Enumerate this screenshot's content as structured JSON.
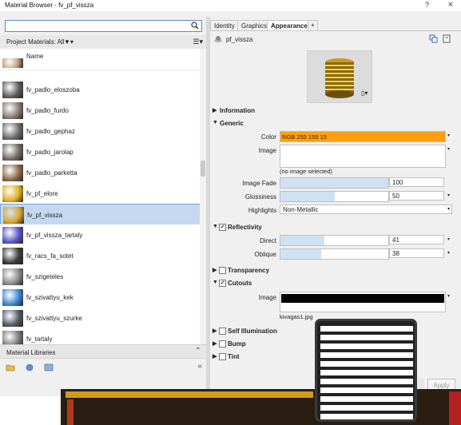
{
  "window": {
    "title": "Material Browser - fv_pf_vissza",
    "help": "?",
    "close": "×"
  },
  "left": {
    "search": {
      "value": "",
      "placeholder": ""
    },
    "filter_label": "Project Materials: All",
    "column_header": "Name",
    "materials": [
      {
        "name": "",
        "color": "#c8a37a"
      },
      {
        "name": "fv_padlo_eloszoba",
        "color": "#5c5c5c"
      },
      {
        "name": "fv_padlo_furdo",
        "color": "#8a7a6e"
      },
      {
        "name": "fv_padlo_gephaz",
        "color": "#6b6b6b"
      },
      {
        "name": "fv_padlo_jarolap",
        "color": "#726a62"
      },
      {
        "name": "fv_padlo_parketta",
        "color": "#8c6a4a"
      },
      {
        "name": "fv_pf_elore",
        "color": "#e0b020"
      },
      {
        "name": "fv_pf_vissza",
        "color": "#d4a630",
        "selected": true
      },
      {
        "name": "fv_pf_vissza_tartaly",
        "color": "#5a56c8"
      },
      {
        "name": "fv_racs_fa_sotet",
        "color": "#3a3a3a"
      },
      {
        "name": "fv_szigeteles",
        "color": "#8a8a8a"
      },
      {
        "name": "fv_szivattyu_kek",
        "color": "#3a86d0"
      },
      {
        "name": "fv_szivattyu_szurke",
        "color": "#505a66"
      },
      {
        "name": "fv_tartaly",
        "color": "#7a7a7a"
      }
    ],
    "libraries_label": "Material Libraries"
  },
  "right": {
    "tabs": [
      "Identity",
      "Graphics",
      "Appearance",
      "+"
    ],
    "active_tab": "Appearance",
    "asset_name": "pf_vissza",
    "sections": {
      "information": "Information",
      "generic": "Generic",
      "reflectivity": "Reflectivity",
      "transparency": "Transparency",
      "cutouts": "Cutouts",
      "self_illumination": "Self Illumination",
      "bump": "Bump",
      "tint": "Tint"
    },
    "generic": {
      "color_label": "Color",
      "color_value": "RGB 255 159 15",
      "color_hex": "#ff9f0f",
      "image_label": "Image",
      "no_image": "(no image selected)",
      "image_fade_label": "Image Fade",
      "image_fade_value": "100",
      "image_fade_fraction": 1.0,
      "glossiness_label": "Glossiness",
      "glossiness_value": "50",
      "glossiness_fraction": 0.5,
      "highlights_label": "Highlights",
      "highlights_value": "Non-Metallic"
    },
    "reflectivity": {
      "direct_label": "Direct",
      "direct_value": "41",
      "direct_fraction": 0.41,
      "oblique_label": "Oblique",
      "oblique_value": "38",
      "oblique_fraction": 0.38
    },
    "cutouts": {
      "image_label": "Image",
      "file_name": "kivagas1.jpg"
    },
    "apply_label": "Apply"
  }
}
